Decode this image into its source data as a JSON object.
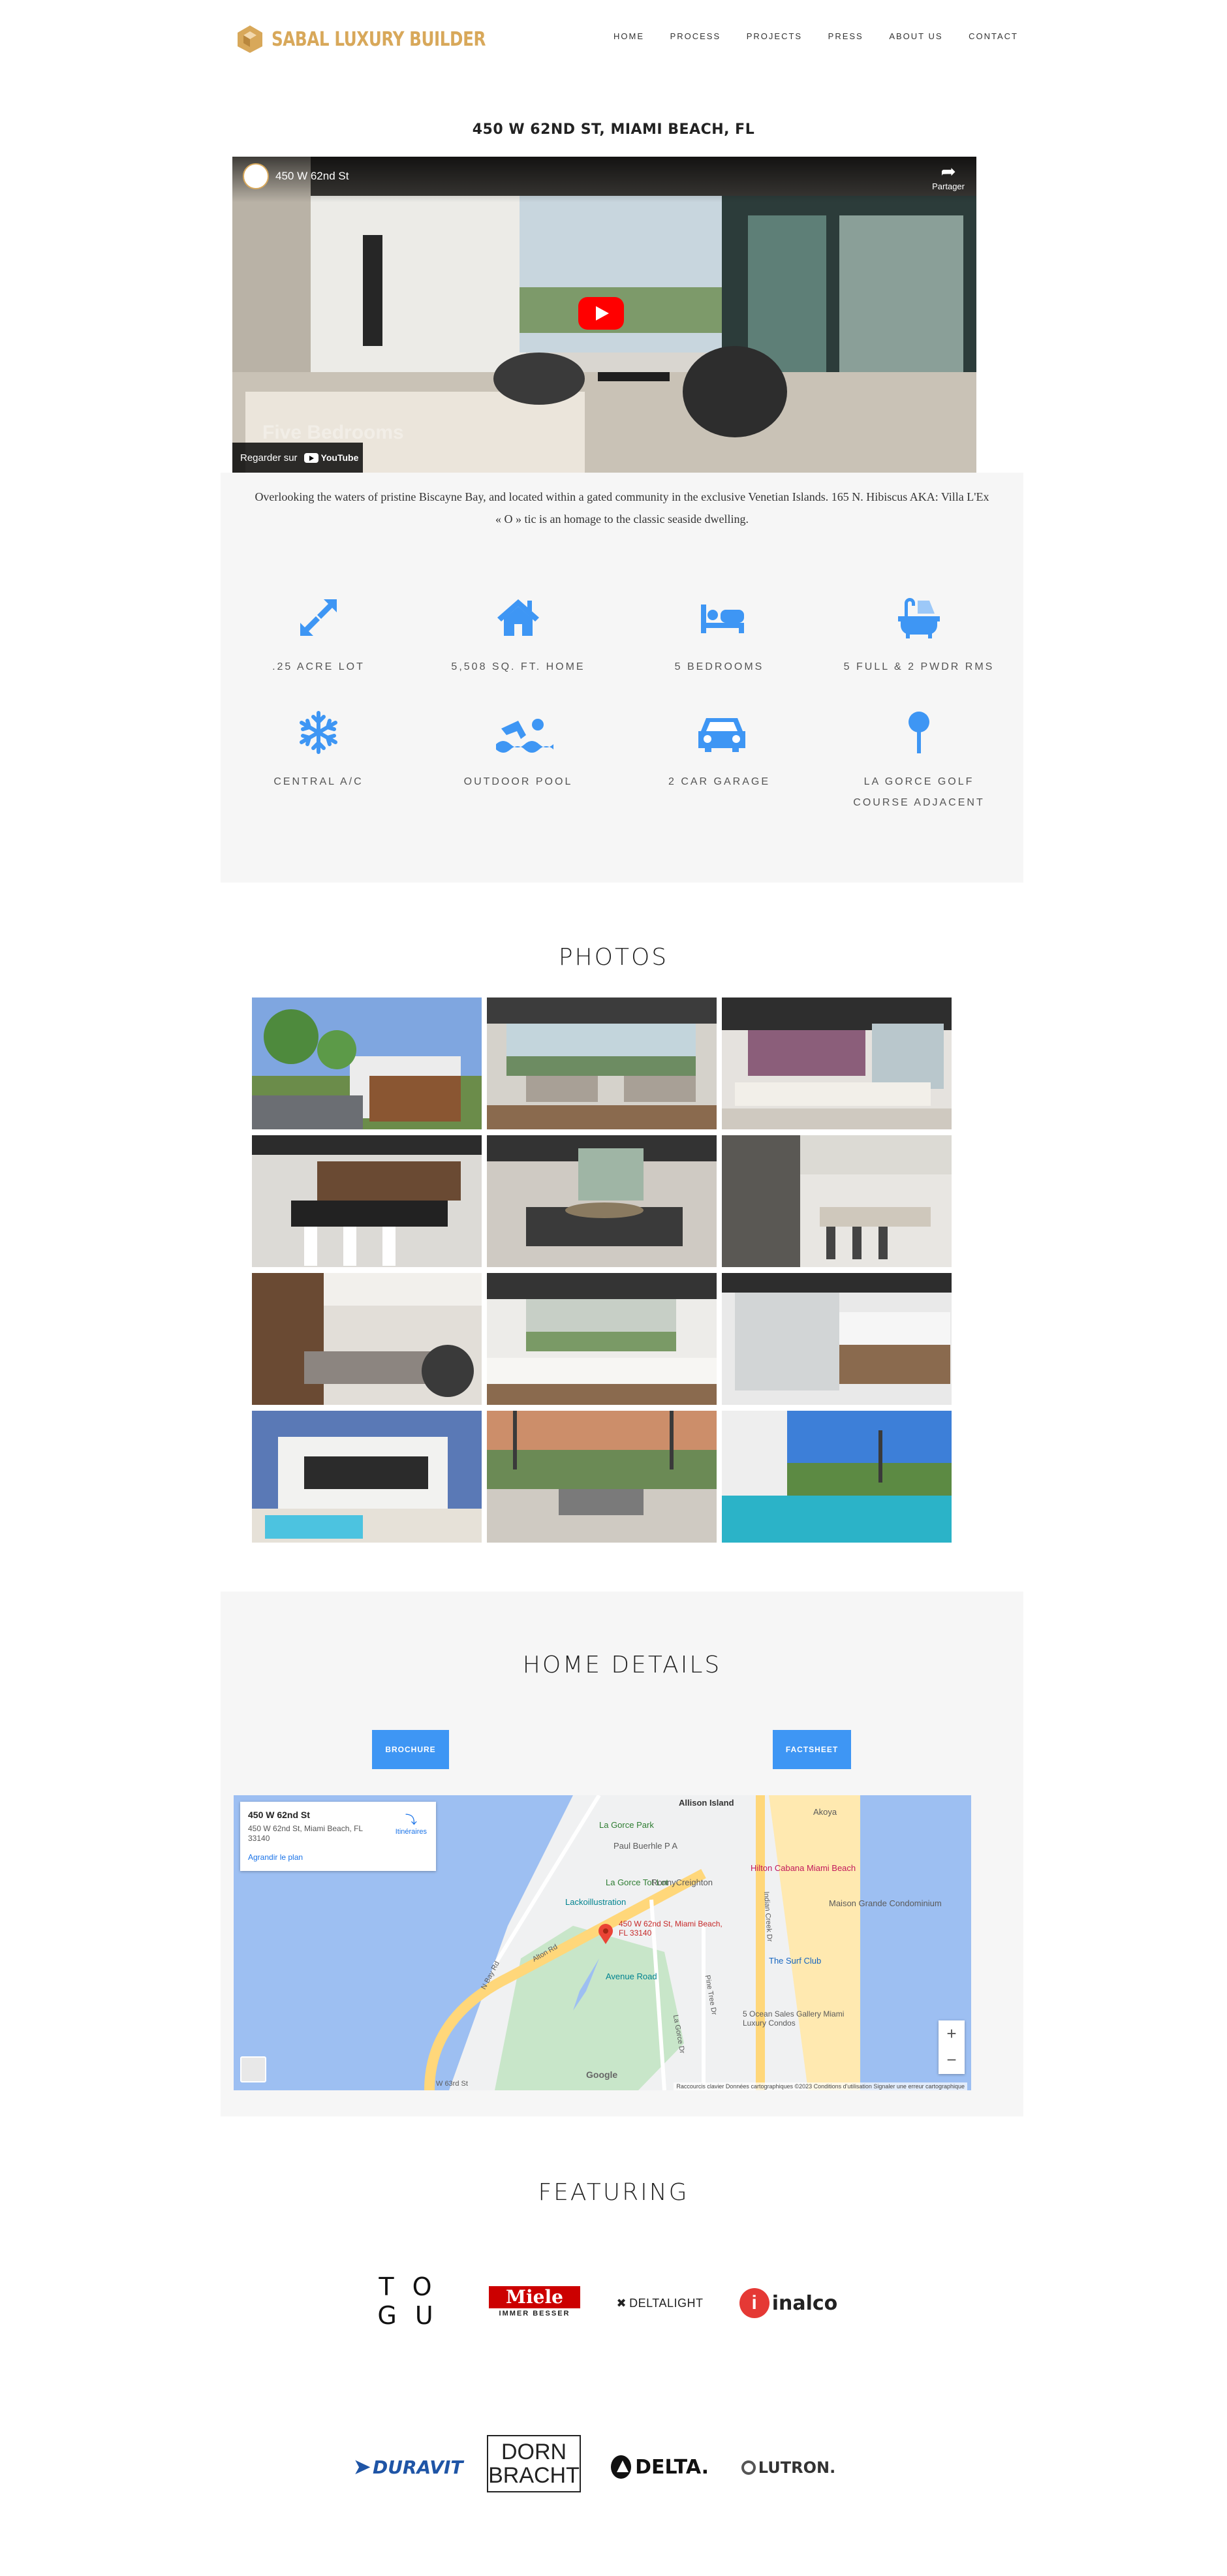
{
  "header": {
    "logo_text": "SABAL LUXURY BUILDER",
    "nav": [
      "HOME",
      "PROCESS",
      "PROJECTS",
      "PRESS",
      "ABOUT US",
      "CONTACT"
    ]
  },
  "property": {
    "title": "450 W 62ND ST, MIAMI BEACH, FL",
    "video": {
      "title": "450 W 62nd St",
      "share_label": "Partager",
      "overlay_caption": "Five Bedrooms",
      "watch_on": "Regarder sur",
      "youtube_label": "YouTube"
    },
    "description": "Overlooking the waters of pristine Biscayne Bay, and located within a gated community in the exclusive Venetian Islands. 165 N. Hibiscus AKA: Villa L'Ex « O » tic is an homage to the classic seaside dwelling.",
    "features": [
      {
        "icon": "expand-arrows-icon",
        "label": ".25 ACRE LOT"
      },
      {
        "icon": "home-icon",
        "label": "5,508 SQ. FT. HOME"
      },
      {
        "icon": "bed-icon",
        "label": "5 BEDROOMS"
      },
      {
        "icon": "bathtub-icon",
        "label": "5 FULL & 2 PWDR RMS"
      },
      {
        "icon": "snowflake-icon",
        "label": "CENTRAL A/C"
      },
      {
        "icon": "swimmer-icon",
        "label": "OUTDOOR POOL"
      },
      {
        "icon": "car-icon",
        "label": "2 CAR GARAGE"
      },
      {
        "icon": "golf-icon",
        "label": "LA GORCE GOLF COURSE ADJACENT"
      }
    ],
    "accent_color": "#3e96f4"
  },
  "photos": {
    "heading": "PHOTOS",
    "count": 12
  },
  "details": {
    "heading": "HOME DETAILS",
    "brochure_label": "BROCHURE",
    "factsheet_label": "FACTSHEET",
    "map": {
      "card_title": "450 W 62nd St",
      "card_address": "450 W 62nd St, Miami Beach, FL 33140",
      "card_directions": "Itinéraires",
      "card_enlarge": "Agrandir le plan",
      "pin_label": "450 W 62nd St, Miami Beach, FL 33140",
      "labels": [
        "Allison Island",
        "La Gorce Park",
        "Paul Buerhle P A",
        "La Gorce Tot Lot",
        "RonnyCreighton",
        "Lackoillustration",
        "Hilton Cabana Miami Beach",
        "Akoya",
        "Maison Grande Condominium",
        "The Surf Club",
        "Avenue Road",
        "5 Ocean Sales Gallery Miami Luxury Condos",
        "Alton Rd",
        "La Gorce Dr",
        "Pine Tree Dr",
        "Indian Creek Dr",
        "N Bay Rd",
        "Google",
        "W 63rd St"
      ],
      "footer": "Raccourcis clavier   Données cartographiques ©2023   Conditions d'utilisation   Signaler une erreur cartographique"
    }
  },
  "featuring": {
    "heading": "FEATURING",
    "brands": [
      {
        "name": "TOGU",
        "top": "T  O",
        "bottom": "G  U"
      },
      {
        "name": "Miele",
        "text": "Miele",
        "tagline": "IMMER BESSER"
      },
      {
        "name": "DELTALIGHT",
        "text": "DELTALIGHT"
      },
      {
        "name": "inalco",
        "text": "inalco"
      },
      {
        "name": "DURAVIT",
        "text": "DURAVIT"
      },
      {
        "name": "DORNBRACHT",
        "top": "DORN",
        "bottom": "BRACHT"
      },
      {
        "name": "DELTA",
        "text": "DELTA."
      },
      {
        "name": "LUTRON",
        "text": "LUTRON."
      }
    ]
  }
}
